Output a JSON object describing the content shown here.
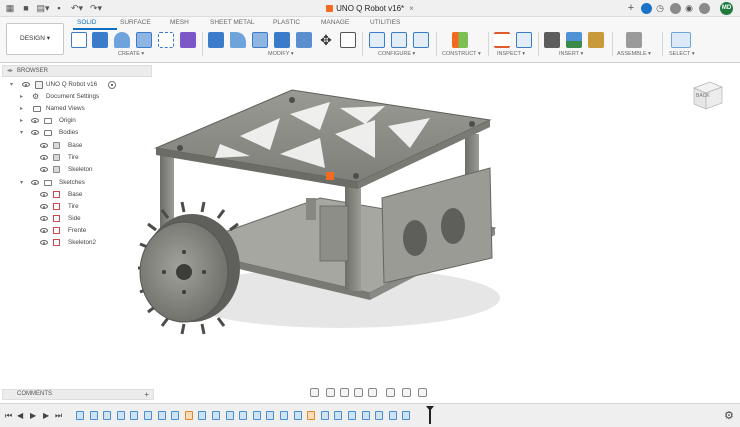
{
  "window": {
    "title": "UNO Q Robot v16*",
    "close_glyph": "×",
    "user_initials": "MD",
    "icons": [
      "grid-icon",
      "save-icon",
      "file-icon",
      "undo-icon",
      "redo-icon",
      "new-tab-icon",
      "help-icon",
      "notifications-icon",
      "account-icon"
    ]
  },
  "ribbon": {
    "workspace_button": "DESIGN ▾",
    "tabs": [
      {
        "label": "SOLID",
        "active": true
      },
      {
        "label": "SURFACE",
        "active": false
      },
      {
        "label": "MESH",
        "active": false
      },
      {
        "label": "SHEET METAL",
        "active": false
      },
      {
        "label": "PLASTIC",
        "active": false
      },
      {
        "label": "MANAGE",
        "active": false
      },
      {
        "label": "UTILITIES",
        "active": false
      }
    ],
    "groups": [
      {
        "label": "CREATE ▾"
      },
      {
        "label": "MODIFY ▾"
      },
      {
        "label": "CONFIGURE ▾"
      },
      {
        "label": "CONSTRUCT ▾"
      },
      {
        "label": "INSPECT ▾"
      },
      {
        "label": "INSERT ▾"
      },
      {
        "label": "ASSEMBLE ▾"
      },
      {
        "label": "SELECT ▾"
      }
    ],
    "colors": {
      "accent": "#0f6fbf",
      "tool_blue": "#3a7cc9",
      "tool_orange": "#f26b21"
    }
  },
  "browser": {
    "header": "BROWSER",
    "items": [
      {
        "label": "UNO Q Robot v16"
      },
      {
        "label": "Document Settings"
      },
      {
        "label": "Named Views"
      },
      {
        "label": "Origin"
      },
      {
        "label": "Bodies"
      },
      {
        "label": "Base"
      },
      {
        "label": "Tire"
      },
      {
        "label": "Skeleton"
      },
      {
        "label": "Sketches"
      },
      {
        "label": "Base"
      },
      {
        "label": "Tire"
      },
      {
        "label": "Side"
      },
      {
        "label": "Frente"
      },
      {
        "label": "Skeleton2"
      }
    ]
  },
  "viewcube": {
    "face_label": "BACK"
  },
  "comments": {
    "label": "COMMENTS",
    "add_glyph": "+"
  },
  "timeline": {
    "controls": [
      "⏮",
      "◀",
      "▶",
      "▶",
      "⏭"
    ],
    "settings_glyph": "⚙"
  }
}
